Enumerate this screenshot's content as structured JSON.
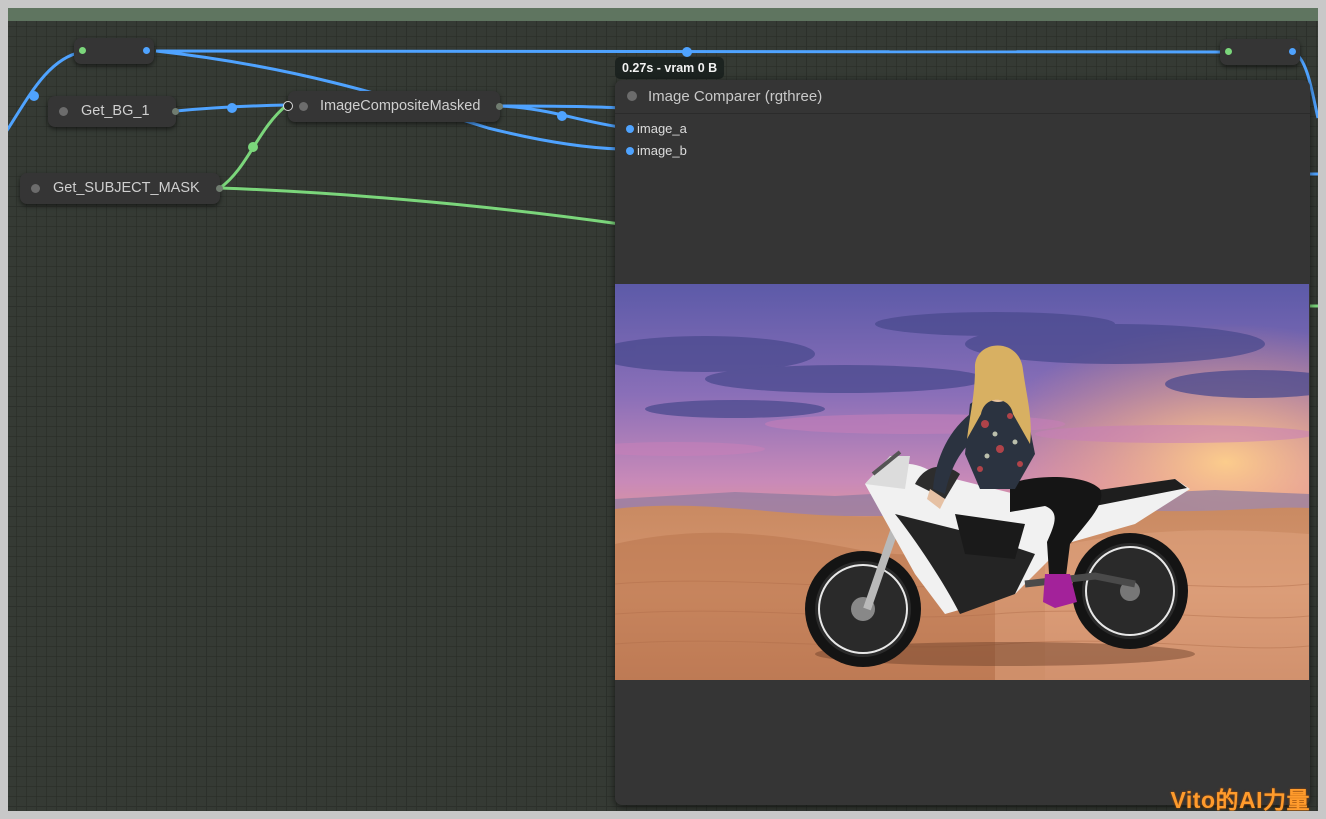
{
  "colors": {
    "image_link": "#4fa3ff",
    "mask_link": "#7bd67b",
    "node_bg": "#353535",
    "canvas_bg": "#353a34"
  },
  "nodes": {
    "get_bg": {
      "label": "Get_BG_1"
    },
    "get_mask": {
      "label": "Get_SUBJECT_MASK"
    },
    "composite": {
      "label": "ImageCompositeMasked"
    },
    "comparer": {
      "title": "Image Comparer (rgthree)",
      "inputs": [
        "image_a",
        "image_b"
      ],
      "exec_badge": "0.27s - vram 0 B"
    }
  },
  "watermark": "Vito的AI力量"
}
